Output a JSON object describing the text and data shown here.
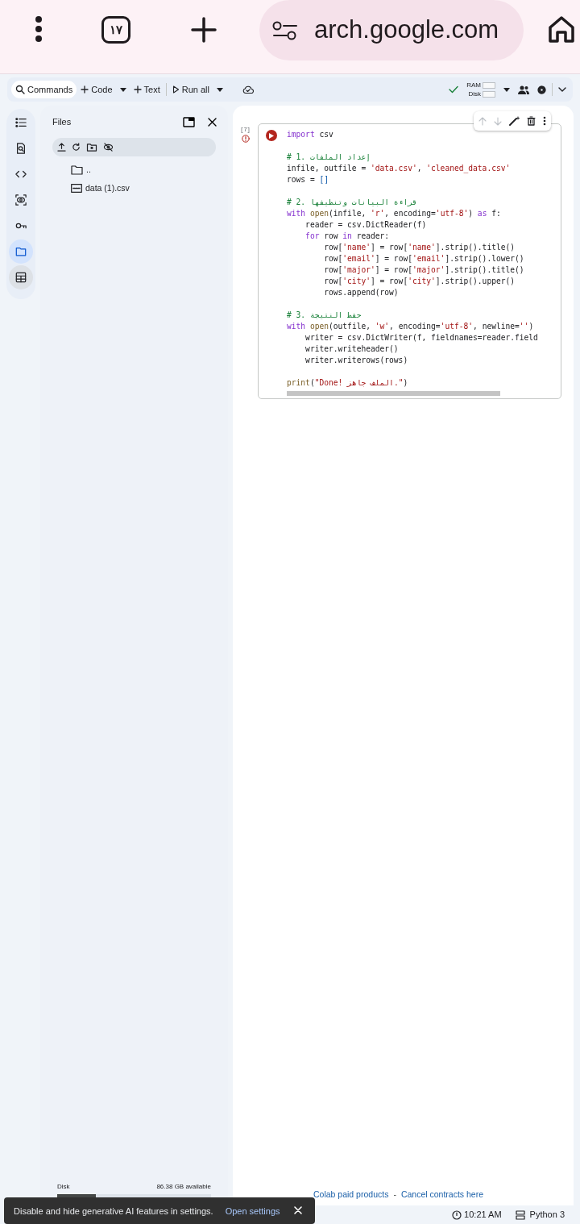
{
  "browser": {
    "tab_count": "١٧",
    "url": "arch.google.com"
  },
  "toolbar": {
    "items": [
      {
        "kind": "search",
        "label": "Commands"
      },
      {
        "kind": "add",
        "label": "Code",
        "menu": true
      },
      {
        "kind": "add",
        "label": "Text",
        "menu": false
      },
      {
        "kind": "run",
        "label": "Run all",
        "menu": true
      }
    ],
    "ram_label": "RAM",
    "disk_label": "Disk",
    "connected": true
  },
  "rail": [
    {
      "kind": "toc",
      "selected": false
    },
    {
      "kind": "find",
      "selected": false
    },
    {
      "kind": "code",
      "selected": false
    },
    {
      "kind": "variables",
      "selected": false
    },
    {
      "kind": "secrets",
      "selected": false
    },
    {
      "kind": "files",
      "selected": true
    },
    {
      "kind": "table",
      "selected": false
    }
  ],
  "files": {
    "title": "Files",
    "entries": [
      {
        "kind": "folder",
        "name": ".."
      },
      {
        "kind": "csv",
        "name": "data (1).csv"
      }
    ],
    "disk": {
      "label": "Disk",
      "available": "86.38 GB available",
      "level": 0.25
    }
  },
  "cell": {
    "exec_count": "[7]",
    "error": true,
    "lines": [
      {
        "gap_before": false,
        "segments": [
          {
            "kind": "kw",
            "text": "import"
          },
          {
            "kind": "plain",
            "text": " csv"
          }
        ]
      },
      {
        "gap_before": true,
        "segments": [
          {
            "kind": "comment",
            "text": "# 1. إعداد الملفات"
          }
        ]
      },
      {
        "gap_before": false,
        "segments": [
          {
            "kind": "plain",
            "text": "infile, outfile = "
          },
          {
            "kind": "str",
            "text": "'data.csv'"
          },
          {
            "kind": "plain",
            "text": ", "
          },
          {
            "kind": "str",
            "text": "'cleaned_data.csv'"
          }
        ]
      },
      {
        "gap_before": false,
        "segments": [
          {
            "kind": "plain",
            "text": "rows = "
          },
          {
            "kind": "bracket",
            "text": "[]"
          }
        ]
      },
      {
        "gap_before": true,
        "segments": [
          {
            "kind": "comment",
            "text": "# 2. قراءة البيانات وتنظيفها"
          }
        ]
      },
      {
        "gap_before": false,
        "segments": [
          {
            "kind": "kw",
            "text": "with"
          },
          {
            "kind": "fn",
            "text": " open"
          },
          {
            "kind": "plain",
            "text": "(infile, "
          },
          {
            "kind": "str",
            "text": "'r'"
          },
          {
            "kind": "plain",
            "text": ", encoding="
          },
          {
            "kind": "str",
            "text": "'utf-8'"
          },
          {
            "kind": "plain",
            "text": ") "
          },
          {
            "kind": "kw",
            "text": "as"
          },
          {
            "kind": "plain",
            "text": " f:"
          }
        ]
      },
      {
        "gap_before": false,
        "segments": [
          {
            "kind": "plain",
            "text": "    reader = csv.DictReader(f)"
          }
        ]
      },
      {
        "gap_before": false,
        "segments": [
          {
            "kind": "kw",
            "text": "    for"
          },
          {
            "kind": "plain",
            "text": " row "
          },
          {
            "kind": "kw",
            "text": "in"
          },
          {
            "kind": "plain",
            "text": " reader:"
          }
        ]
      },
      {
        "gap_before": false,
        "segments": [
          {
            "kind": "plain",
            "text": "        row["
          },
          {
            "kind": "str",
            "text": "'name'"
          },
          {
            "kind": "plain",
            "text": "] = row["
          },
          {
            "kind": "str",
            "text": "'name'"
          },
          {
            "kind": "plain",
            "text": "].strip().title()"
          }
        ]
      },
      {
        "gap_before": false,
        "segments": [
          {
            "kind": "plain",
            "text": "        row["
          },
          {
            "kind": "str",
            "text": "'email'"
          },
          {
            "kind": "plain",
            "text": "] = row["
          },
          {
            "kind": "str",
            "text": "'email'"
          },
          {
            "kind": "plain",
            "text": "].strip().lower()"
          }
        ]
      },
      {
        "gap_before": false,
        "segments": [
          {
            "kind": "plain",
            "text": "        row["
          },
          {
            "kind": "str",
            "text": "'major'"
          },
          {
            "kind": "plain",
            "text": "] = row["
          },
          {
            "kind": "str",
            "text": "'major'"
          },
          {
            "kind": "plain",
            "text": "].strip().title()"
          }
        ]
      },
      {
        "gap_before": false,
        "segments": [
          {
            "kind": "plain",
            "text": "        row["
          },
          {
            "kind": "str",
            "text": "'city'"
          },
          {
            "kind": "plain",
            "text": "] = row["
          },
          {
            "kind": "str",
            "text": "'city'"
          },
          {
            "kind": "plain",
            "text": "].strip().upper()"
          }
        ]
      },
      {
        "gap_before": false,
        "segments": [
          {
            "kind": "plain",
            "text": "        rows.append(row)"
          }
        ]
      },
      {
        "gap_before": true,
        "segments": [
          {
            "kind": "comment",
            "text": "# 3. حفظ النتيجة"
          }
        ]
      },
      {
        "gap_before": false,
        "segments": [
          {
            "kind": "kw",
            "text": "with"
          },
          {
            "kind": "fn",
            "text": " open"
          },
          {
            "kind": "plain",
            "text": "(outfile, "
          },
          {
            "kind": "str",
            "text": "'w'"
          },
          {
            "kind": "plain",
            "text": ", encoding="
          },
          {
            "kind": "str",
            "text": "'utf-8'"
          },
          {
            "kind": "plain",
            "text": ", newline="
          },
          {
            "kind": "str",
            "text": "''"
          },
          {
            "kind": "plain",
            "text": ")"
          }
        ]
      },
      {
        "gap_before": false,
        "segments": [
          {
            "kind": "plain",
            "text": "    writer = csv.DictWriter(f, fieldnames=reader.field"
          }
        ]
      },
      {
        "gap_before": false,
        "segments": [
          {
            "kind": "plain",
            "text": "    writer.writeheader()"
          }
        ]
      },
      {
        "gap_before": false,
        "segments": [
          {
            "kind": "plain",
            "text": "    writer.writerows(rows)"
          }
        ]
      },
      {
        "gap_before": true,
        "segments": [
          {
            "kind": "fn",
            "text": "print"
          },
          {
            "kind": "plain",
            "text": "("
          },
          {
            "kind": "str",
            "text": "\"Done! الملف جاهز.\""
          },
          {
            "kind": "plain",
            "text": ")"
          }
        ]
      }
    ]
  },
  "footer": {
    "links": [
      "Colab paid products",
      "Cancel contracts here"
    ],
    "separator": "-"
  },
  "toast": {
    "message": "Disable and hide generative AI features in settings.",
    "action": "Open settings"
  },
  "status": {
    "time": "10:21 AM",
    "runtime": "Python 3"
  }
}
